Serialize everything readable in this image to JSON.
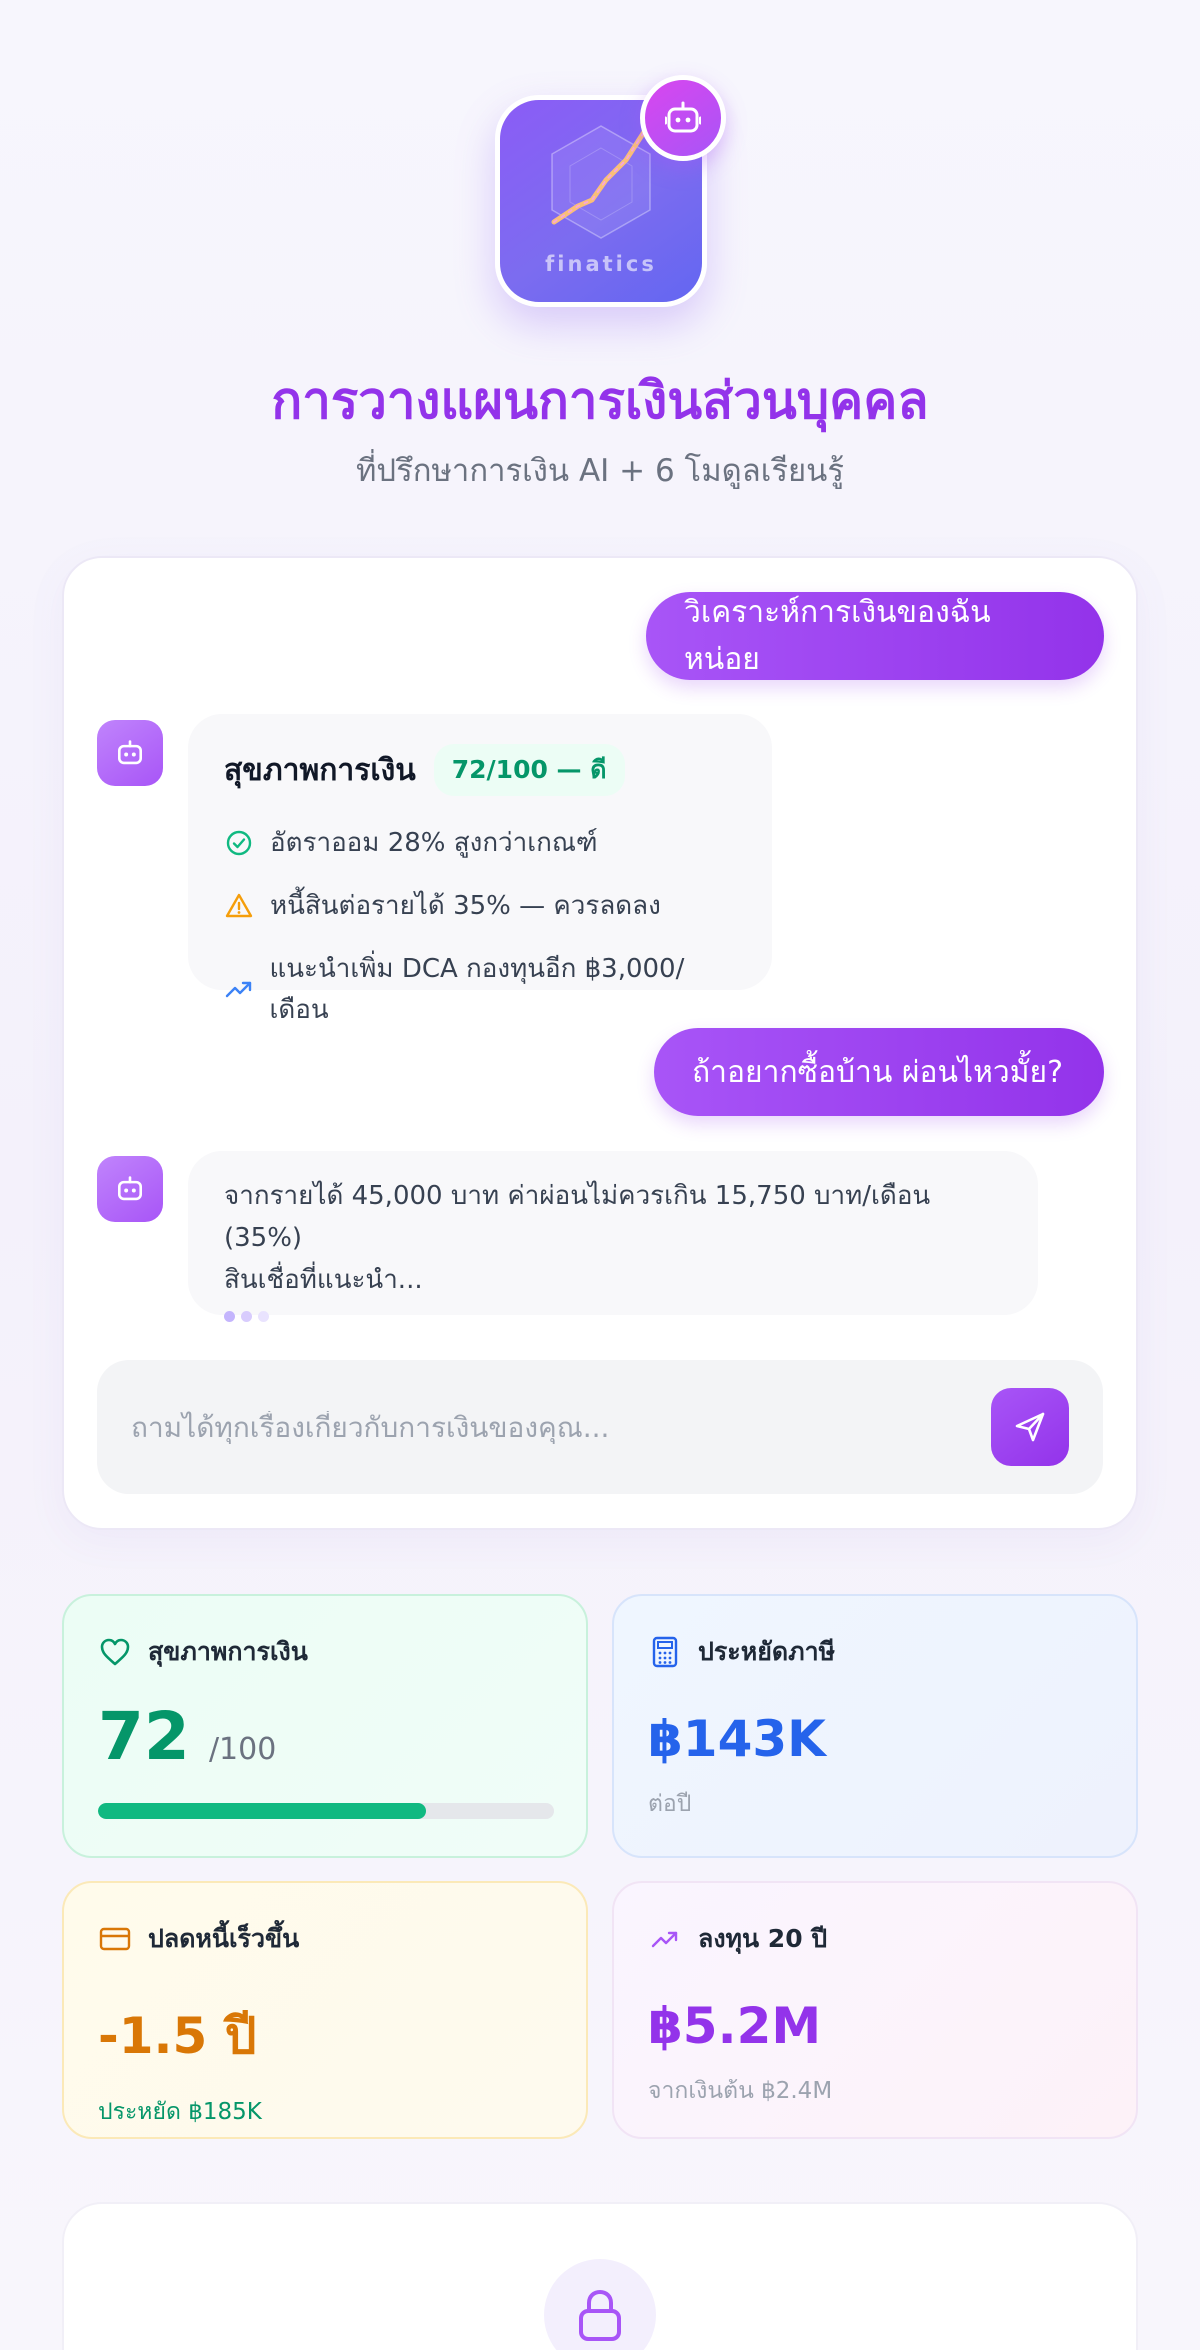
{
  "logo": {
    "text": "finatics",
    "icon": "robot-icon"
  },
  "header": {
    "title": "การวางแผนการเงินส่วนบุคคล",
    "subtitle": "ที่ปรึกษาการเงิน AI + 6 โมดูลเรียนรู้"
  },
  "chat": {
    "messages": [
      {
        "role": "user",
        "text": "วิเคราะห์การเงินของฉันหน่อย"
      },
      {
        "role": "bot",
        "title": "สุขภาพการเงิน",
        "badge": "72/100 — ดี",
        "bullets": [
          {
            "icon": "check-circle-icon",
            "color": "#10b981",
            "text": "อัตราออม 28% สูงกว่าเกณฑ์"
          },
          {
            "icon": "warning-icon",
            "color": "#f59e0b",
            "text": "หนี้สินต่อรายได้ 35% — ควรลดลง"
          },
          {
            "icon": "trending-up-icon",
            "color": "#3b82f6",
            "text": "แนะนำเพิ่ม DCA กองทุนอีก ฿3,000/เดือน"
          }
        ]
      },
      {
        "role": "user",
        "text": "ถ้าอยากซื้อบ้าน ผ่อนไหวมั้ย?"
      },
      {
        "role": "bot",
        "line1": "จากรายได้ 45,000 บาท ค่าผ่อนไม่ควรเกิน 15,750 บาท/เดือน (35%)",
        "line2": "สินเชื่อที่แนะนำ..."
      }
    ],
    "input": {
      "placeholder": "ถามได้ทุกเรื่องเกี่ยวกับการเงินของคุณ...",
      "value": ""
    },
    "send_icon": "send-icon"
  },
  "stats": {
    "health": {
      "label": "สุขภาพการเงิน",
      "value": "72",
      "suffix": "/100",
      "progress": 0.72,
      "color": "#059669",
      "icon": "heart-icon"
    },
    "tax": {
      "label": "ประหยัดภาษี",
      "value": "฿143K",
      "sub": "ต่อปี",
      "color": "#2563eb",
      "icon": "calculator-icon"
    },
    "debt": {
      "label": "ปลดหนี้เร็วขึ้น",
      "value": "-1.5 ปี",
      "sub": "ประหยัด ฿185K",
      "color": "#d97706",
      "sub_color": "#059669",
      "icon": "credit-card-icon"
    },
    "invest": {
      "label": "ลงทุน 20 ปี",
      "value": "฿5.2M",
      "sub": "จากเงินต้น ฿2.4M",
      "color": "#9333ea",
      "icon": "trending-up-icon"
    }
  },
  "locked_section": {
    "icon": "lock-icon"
  },
  "colors": {
    "accent": "#9333ea",
    "accent_light": "#a855f7",
    "success": "#059669"
  }
}
